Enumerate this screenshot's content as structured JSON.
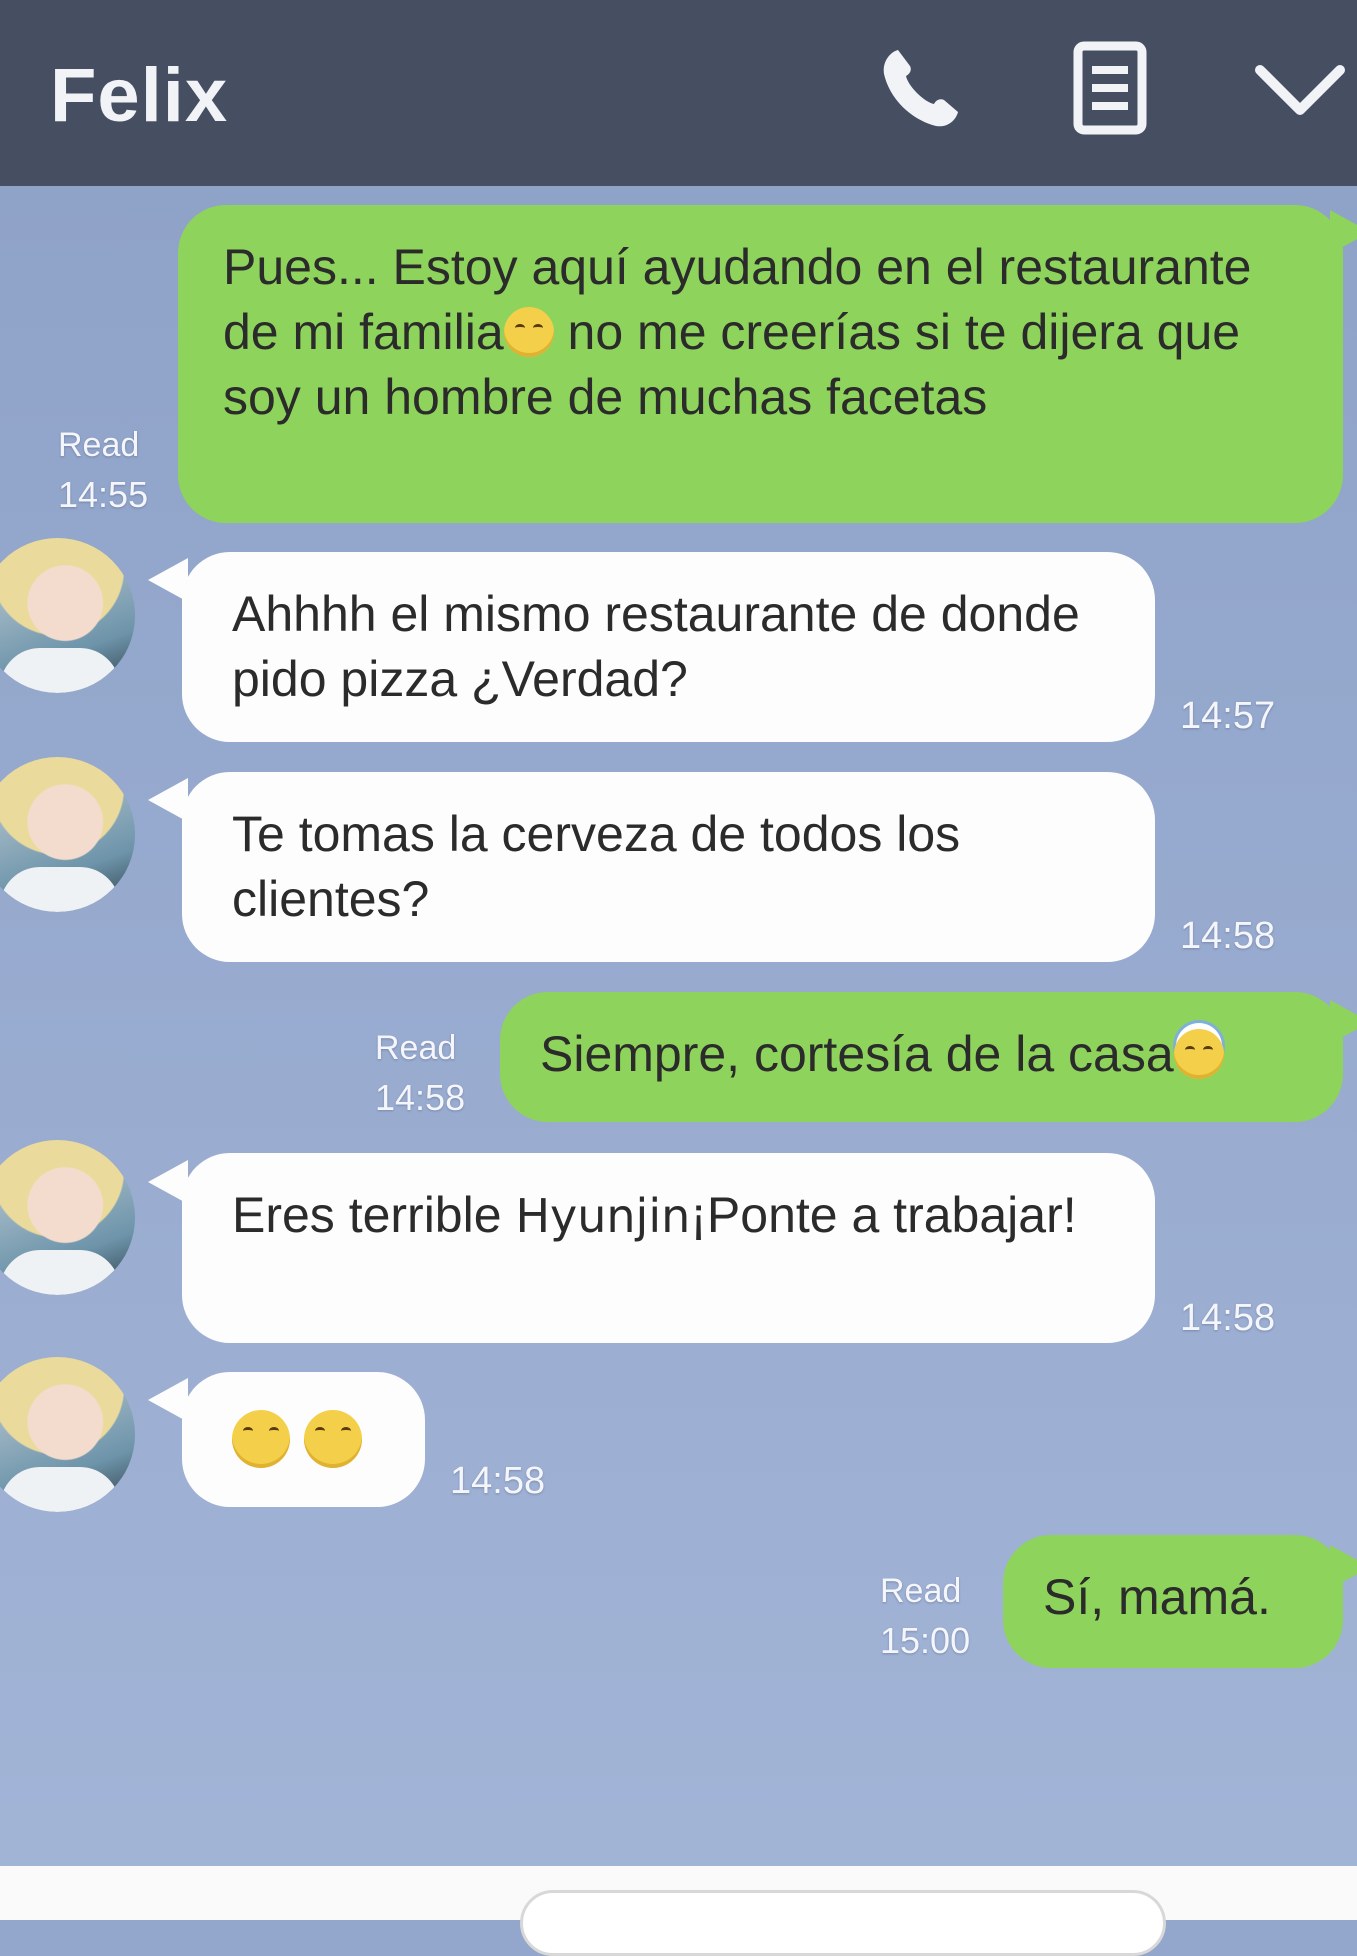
{
  "header": {
    "title": "Felix",
    "bg": "#454f61",
    "icons": [
      "phone-icon",
      "menu-icon",
      "chevron-down-icon"
    ]
  },
  "messages": [
    {
      "side": "out",
      "text_parts": [
        "Pues... Estoy aquí ayudando en el restaurante de mi familia",
        " no me creerías si te dijera que soy un hombre de muchas facetas"
      ],
      "read": "Read",
      "time": "14:55"
    },
    {
      "side": "in",
      "text": "Ahhhh el mismo restaurante de donde pido pizza ¿Verdad?",
      "time": "14:57"
    },
    {
      "side": "in",
      "text": "Te tomas la cerveza de todos los clientes?",
      "time": "14:58"
    },
    {
      "side": "out",
      "text": "Siempre, cortesía de la casa",
      "read": "Read",
      "time": "14:58"
    },
    {
      "side": "in",
      "text_parts": [
        "Eres terrible ",
        "Hyunjin",
        "¡Ponte a trabajar!"
      ],
      "time": "14:58"
    },
    {
      "side": "in",
      "text": "",
      "time": "14:58"
    },
    {
      "side": "out",
      "text": "Sí, mamá.",
      "read": "Read",
      "time": "15:00"
    }
  ],
  "colors": {
    "outgoing": "#8ed35b",
    "incoming": "#fdfdfd",
    "background": "#93a6cb"
  }
}
